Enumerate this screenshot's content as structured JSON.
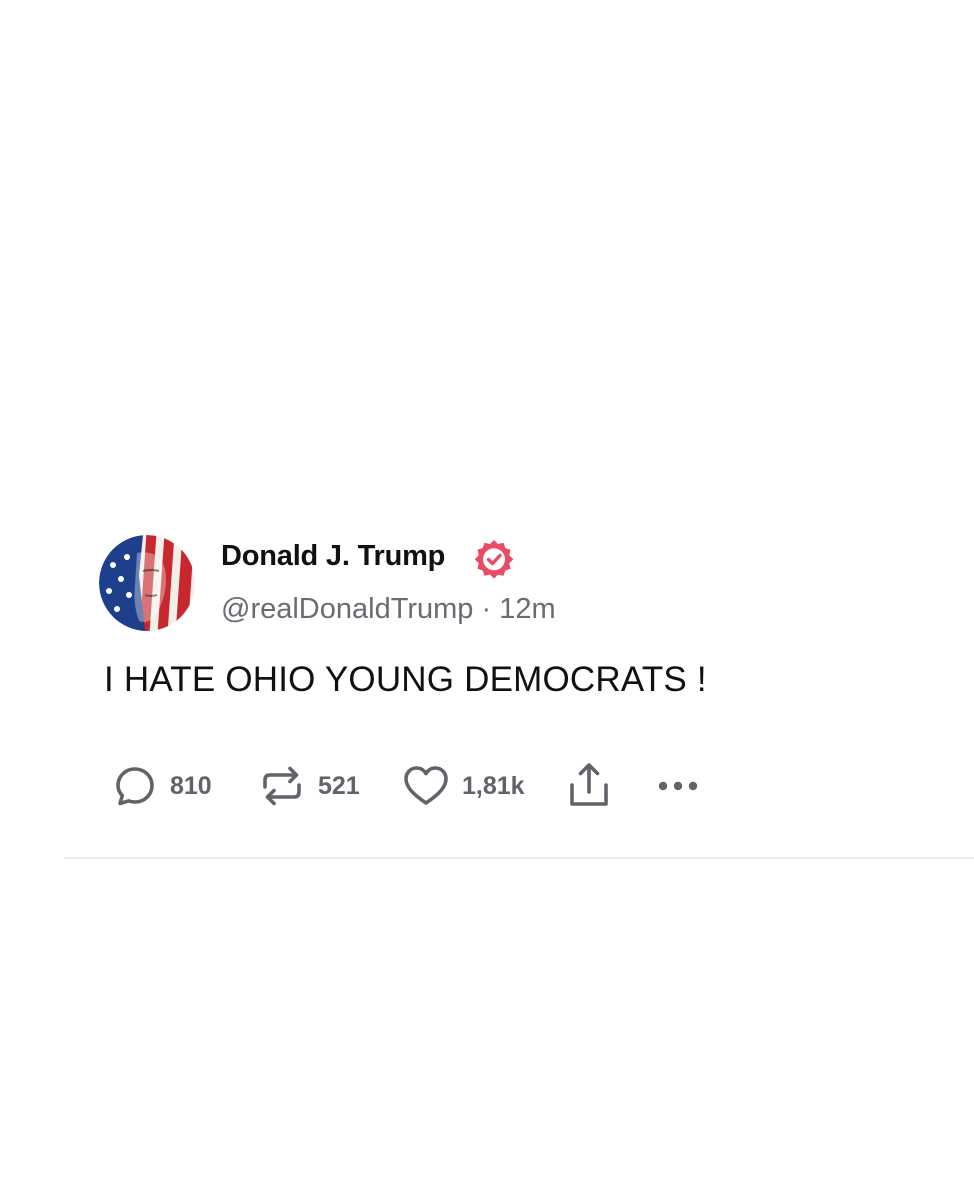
{
  "post": {
    "author": {
      "display_name": "Donald J. Trump",
      "handle": "@realDonaldTrump",
      "verified_icon": "verified-badge-icon",
      "verified_color": "#ea4c67"
    },
    "time_separator": "·",
    "timestamp": "12m",
    "text": "I HATE OHIO YOUNG DEMOCRATS !",
    "actions": {
      "replies": {
        "icon": "reply-bubble-icon",
        "count": "810"
      },
      "reposts": {
        "icon": "repost-icon",
        "count": "521"
      },
      "likes": {
        "icon": "heart-icon",
        "count": "1,81k"
      },
      "share": {
        "icon": "share-icon"
      },
      "more": {
        "icon": "more-dots-icon"
      }
    }
  },
  "colors": {
    "text_primary": "#111111",
    "text_secondary": "#6b6b73",
    "icon_gray": "#62626b",
    "divider": "#ececef"
  }
}
